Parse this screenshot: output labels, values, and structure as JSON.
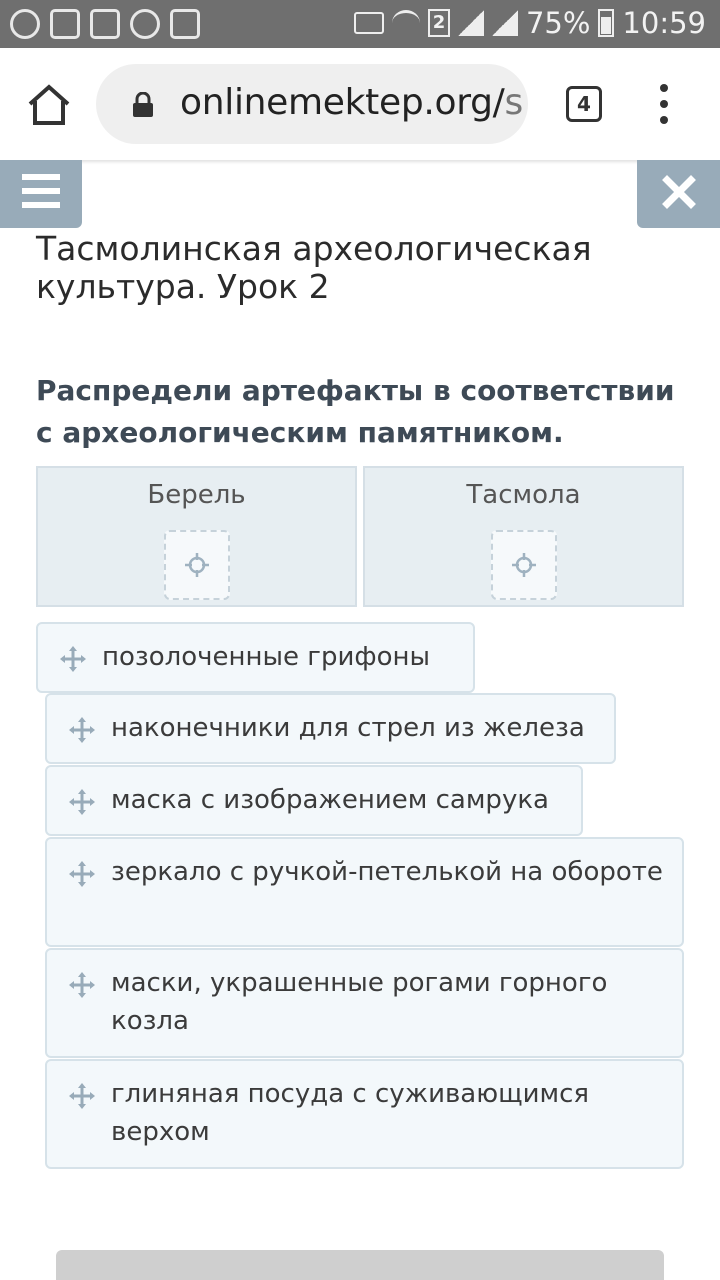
{
  "status_bar": {
    "battery": "75%",
    "time": "10:59",
    "sim": "2"
  },
  "browser": {
    "url_main": "onlinemektep.org/",
    "url_tail": "s",
    "tab_count": "4"
  },
  "page": {
    "lesson_title": "Тасмолинская археологическая культура. Урок 2",
    "instruction": "Распредели артефакты в соответствии с археологическим памятником.",
    "drop_zones": [
      {
        "label": "Берель"
      },
      {
        "label": "Тасмола"
      }
    ],
    "cards": [
      {
        "text": "позолоченные грифоны"
      },
      {
        "text": "наконечники для стрел из железа"
      },
      {
        "text": "маска с изображением самрука"
      },
      {
        "text": "зеркало с ручкой-петелькой на обороте"
      },
      {
        "text": "маски, украшенные рогами горного козла"
      },
      {
        "text": "глиняная посуда с суживающимся верхом"
      }
    ]
  },
  "colors": {
    "accent_button": "#98abb9",
    "zone_bg": "#e7eef2",
    "card_bg": "#f3f8fb"
  }
}
